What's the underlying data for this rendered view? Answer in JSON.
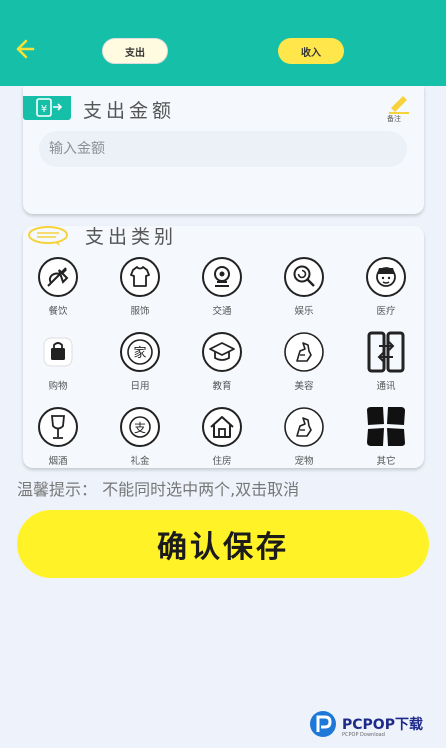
{
  "header": {
    "back_icon": "arrow-left-icon",
    "tabs": [
      {
        "label": "支出",
        "active": true
      },
      {
        "label": "收入",
        "active": false
      }
    ],
    "bg_color": "#16bfa8",
    "accent_yellow": "#ffe64a"
  },
  "amount_section": {
    "title": "支出金额",
    "note_label": "备注",
    "input_placeholder": "输入金额",
    "input_value": ""
  },
  "category_section": {
    "title": "支出类别",
    "items": [
      {
        "label": "餐饮",
        "icon": "dining-icon"
      },
      {
        "label": "服饰",
        "icon": "tshirt-icon"
      },
      {
        "label": "交通",
        "icon": "transport-icon"
      },
      {
        "label": "娱乐",
        "icon": "lollipop-icon"
      },
      {
        "label": "医疗",
        "icon": "doctor-icon"
      },
      {
        "label": "购物",
        "icon": "shopping-bag-icon"
      },
      {
        "label": "日用",
        "icon": "home-goods-icon"
      },
      {
        "label": "教育",
        "icon": "graduation-cap-icon"
      },
      {
        "label": "美容",
        "icon": "beauty-icon"
      },
      {
        "label": "通讯",
        "icon": "phones-icon"
      },
      {
        "label": "烟酒",
        "icon": "wine-glass-icon"
      },
      {
        "label": "礼金",
        "icon": "gift-money-icon"
      },
      {
        "label": "住房",
        "icon": "house-icon"
      },
      {
        "label": "宠物",
        "icon": "pet-icon"
      },
      {
        "label": "其它",
        "icon": "other-icon"
      }
    ]
  },
  "tip": "温馨提示： 不能同时选中两个,双击取消",
  "save_button": "确认保存",
  "watermark": {
    "brand": "PCPOP下载",
    "sub": "PCPOP Download"
  }
}
